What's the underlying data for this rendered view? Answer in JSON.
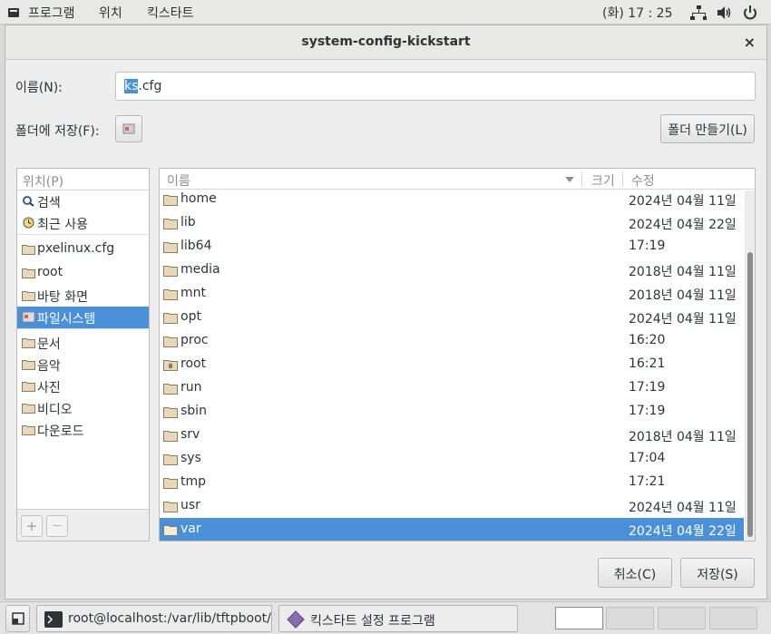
{
  "topbar": {
    "menus": [
      "프로그램",
      "위치",
      "킥스타트"
    ],
    "clock": "(화) 17 : 25",
    "icons": [
      "network-icon",
      "volume-icon",
      "power-icon"
    ]
  },
  "dialog": {
    "title": "system-config-kickstart",
    "close": "×",
    "name_label": "이름(N):",
    "filename_selected": "ks",
    "filename_rest": ".cfg",
    "save_in_label": "폴더에 저장(F):",
    "new_folder_button": "폴더 만들기(L)",
    "cancel_button": "취소(C)",
    "save_button": "저장(S)"
  },
  "places": {
    "header": "위치(P)",
    "items": [
      {
        "label": "검색",
        "icon": "search-icon"
      },
      {
        "label": "최근 사용",
        "icon": "clock-icon"
      },
      {
        "label": "pxelinux.cfg",
        "icon": "folder-icon"
      },
      {
        "label": "root",
        "icon": "home-folder-icon"
      },
      {
        "label": "바탕 화면",
        "icon": "desktop-folder-icon"
      },
      {
        "label": "파일시스템",
        "icon": "drive-icon",
        "selected": true
      },
      {
        "label": "문서",
        "icon": "documents-folder-icon"
      },
      {
        "label": "음악",
        "icon": "music-folder-icon"
      },
      {
        "label": "사진",
        "icon": "pictures-folder-icon"
      },
      {
        "label": "비디오",
        "icon": "videos-folder-icon"
      },
      {
        "label": "다운로드",
        "icon": "downloads-folder-icon"
      }
    ],
    "add": "+",
    "remove": "—"
  },
  "files": {
    "columns": {
      "name": "이름",
      "size": "크기",
      "modified": "수정"
    },
    "rows": [
      {
        "name": "home",
        "modified": "2024년 04월 11일"
      },
      {
        "name": "lib",
        "modified": "2024년 04월 22일"
      },
      {
        "name": "lib64",
        "modified": "17:19"
      },
      {
        "name": "media",
        "modified": "2018년 04월 11일"
      },
      {
        "name": "mnt",
        "modified": "2018년 04월 11일"
      },
      {
        "name": "opt",
        "modified": "2024년 04월 11일"
      },
      {
        "name": "proc",
        "modified": "16:20"
      },
      {
        "name": "root",
        "modified": "16:21",
        "home": true
      },
      {
        "name": "run",
        "modified": "17:19"
      },
      {
        "name": "sbin",
        "modified": "17:19"
      },
      {
        "name": "srv",
        "modified": "2018년 04월 11일"
      },
      {
        "name": "sys",
        "modified": "17:04"
      },
      {
        "name": "tmp",
        "modified": "17:21"
      },
      {
        "name": "usr",
        "modified": "2024년 04월 11일"
      },
      {
        "name": "var",
        "modified": "2024년 04월 22일",
        "selected": true
      }
    ]
  },
  "taskbar": {
    "terminal_task": "root@localhost:/var/lib/tftpboot/px…",
    "kickstart_task": "킥스타트 설정 프로그램"
  },
  "colors": {
    "selection": "#4a90d9",
    "background": "#ededed"
  }
}
